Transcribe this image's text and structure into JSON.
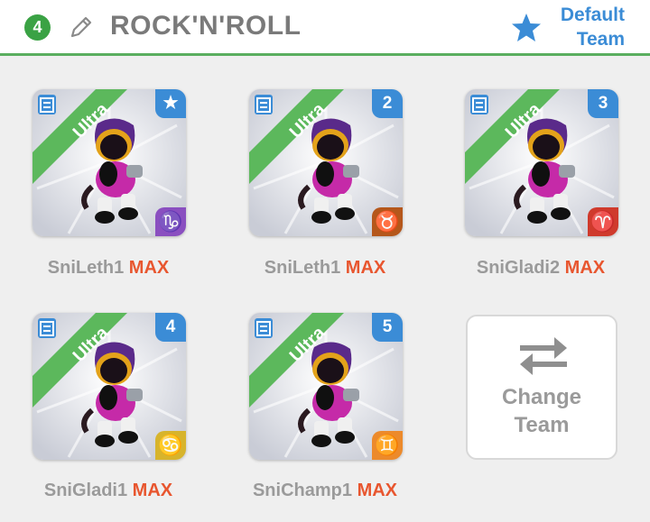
{
  "header": {
    "team_number": "4",
    "team_name": "ROCK'N'ROLL",
    "default_line1": "Default",
    "default_line2": "Team"
  },
  "cards": [
    {
      "slot": "★",
      "rarity": "Ultra",
      "name": "SniLeth1",
      "level": "MAX",
      "sign": "♑",
      "sign_color": "#8a4fc0"
    },
    {
      "slot": "2",
      "rarity": "Ultra",
      "name": "SniLeth1",
      "level": "MAX",
      "sign": "♉",
      "sign_color": "#b5571b"
    },
    {
      "slot": "3",
      "rarity": "Ultra",
      "name": "SniGladi2",
      "level": "MAX",
      "sign": "♈",
      "sign_color": "#cf3a2c"
    },
    {
      "slot": "4",
      "rarity": "Ultra",
      "name": "SniGladi1",
      "level": "MAX",
      "sign": "♋",
      "sign_color": "#d7b42c"
    },
    {
      "slot": "5",
      "rarity": "Ultra",
      "name": "SniChamp1",
      "level": "MAX",
      "sign": "♊",
      "sign_color": "#ec8a2b"
    }
  ],
  "change_team": {
    "line1": "Change",
    "line2": "Team",
    "icon": "swap-arrows-icon"
  },
  "colors": {
    "accent_blue": "#3b8cd6",
    "ultra_green": "#5cb85c",
    "max_orange": "#e8562f",
    "team_green": "#3aa244"
  }
}
